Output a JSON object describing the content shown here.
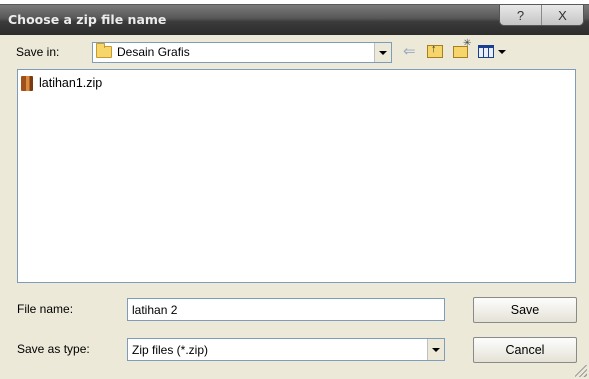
{
  "window": {
    "title": "Choose a zip file name",
    "help_glyph": "?",
    "close_glyph": "X"
  },
  "toolbar": {
    "save_in_label": "Save in:",
    "save_in_value": "Desain Grafis"
  },
  "files": [
    {
      "name": "latihan1.zip"
    }
  ],
  "form": {
    "file_name_label": "File name:",
    "file_name_value": "latihan 2",
    "save_as_type_label": "Save as type:",
    "save_as_type_value": "Zip files (*.zip)"
  },
  "buttons": {
    "save": "Save",
    "cancel": "Cancel"
  }
}
